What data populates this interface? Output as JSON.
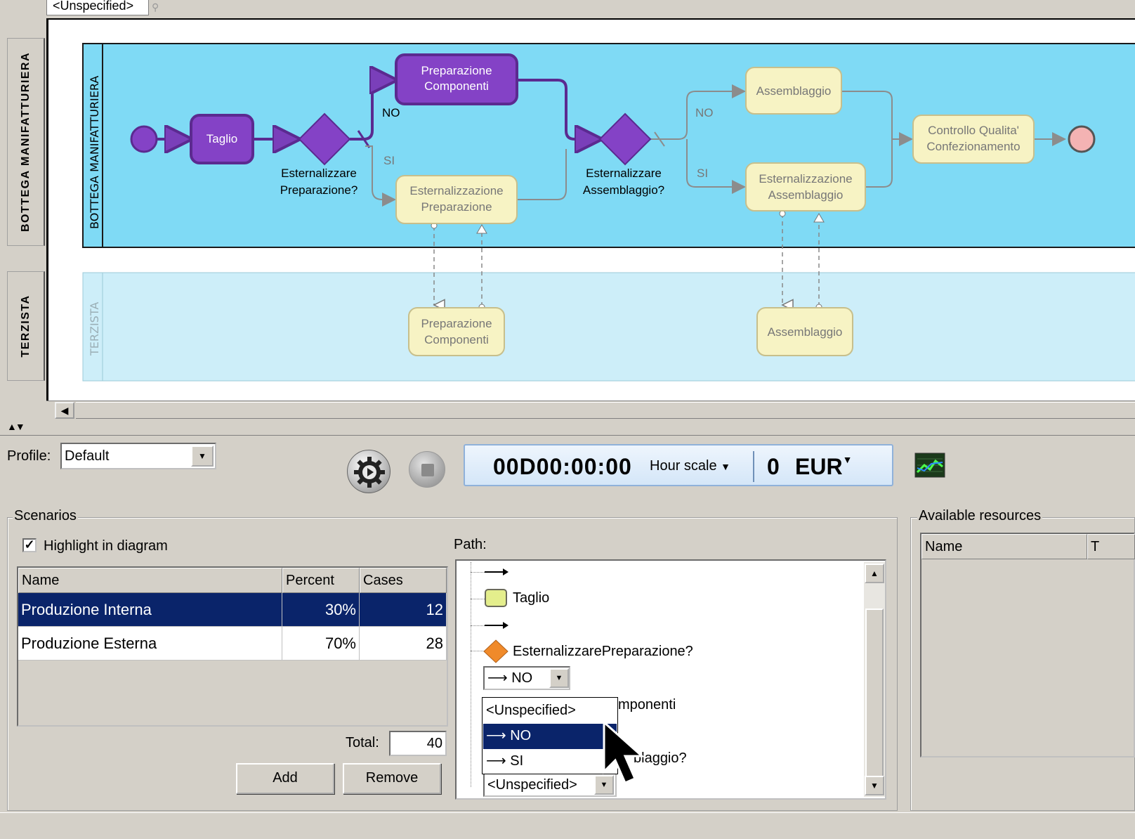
{
  "diagram": {
    "top_combo": "<Unspecified>",
    "pools": [
      {
        "tab": "BOTTEGA MANIFATTURIERA",
        "lane": "BOTTEGA MANIFATTURIERA"
      },
      {
        "tab": "TERZISTA",
        "lane": "TERZISTA"
      }
    ],
    "tasks": {
      "taglio": "Taglio",
      "prep_comp": [
        "Preparazione",
        "Componenti"
      ],
      "est_prep": [
        "Esternalizzazione",
        "Preparazione"
      ],
      "assemblaggio": "Assemblaggio",
      "est_ass": [
        "Esternalizzazione",
        "Assemblaggio"
      ],
      "controllo": [
        "Controllo Qualita'",
        "Confezionamento"
      ],
      "terz_prep": [
        "Preparazione",
        "Componenti"
      ],
      "terz_ass": "Assemblaggio"
    },
    "gateways": {
      "g1": [
        "Esternalizzare",
        "Preparazione?"
      ],
      "g2": [
        "Esternalizzare",
        "Assemblaggio?"
      ]
    },
    "flow_labels": {
      "no1": "NO",
      "si1": "SI",
      "no2": "NO",
      "si2": "SI"
    },
    "colors": {
      "pool": "#7fdaf5",
      "lane2": "#cdeef9",
      "highlight": "#8442c6",
      "task": "#f7f3c4",
      "end": "#f4b3b3"
    }
  },
  "toolbar": {
    "profile_label": "Profile:",
    "profile_value": "Default",
    "time": "00D00:00:00",
    "hour_scale": "Hour scale",
    "cost": "0",
    "currency": "EUR",
    "run_icon": "gear-play-icon",
    "stop_icon": "stop-icon",
    "chart_icon": "line-chart-icon"
  },
  "scenarios": {
    "title": "Scenarios",
    "highlight_label": "Highlight in diagram",
    "highlight_checked": true,
    "columns": [
      "Name",
      "Percent",
      "Cases"
    ],
    "rows": [
      {
        "name": "Produzione Interna",
        "percent": "30%",
        "cases": "12",
        "selected": true
      },
      {
        "name": "Produzione Esterna",
        "percent": "70%",
        "cases": "28",
        "selected": false
      }
    ],
    "total_label": "Total:",
    "total_value": "40",
    "add_label": "Add",
    "remove_label": "Remove"
  },
  "path": {
    "label": "Path:",
    "items": {
      "taglio": "Taglio",
      "gateway1": "EsternalizzarePreparazione?",
      "gateway1_choice": "NO",
      "hidden_task_suffix": "mponenti",
      "hidden_gateway_suffix": "blaggio?",
      "last_combo": "<Unspecified>"
    },
    "dropdown": [
      "<Unspecified>",
      "NO",
      "SI"
    ]
  },
  "resources": {
    "title": "Available resources",
    "columns": [
      "Name",
      "T"
    ]
  }
}
